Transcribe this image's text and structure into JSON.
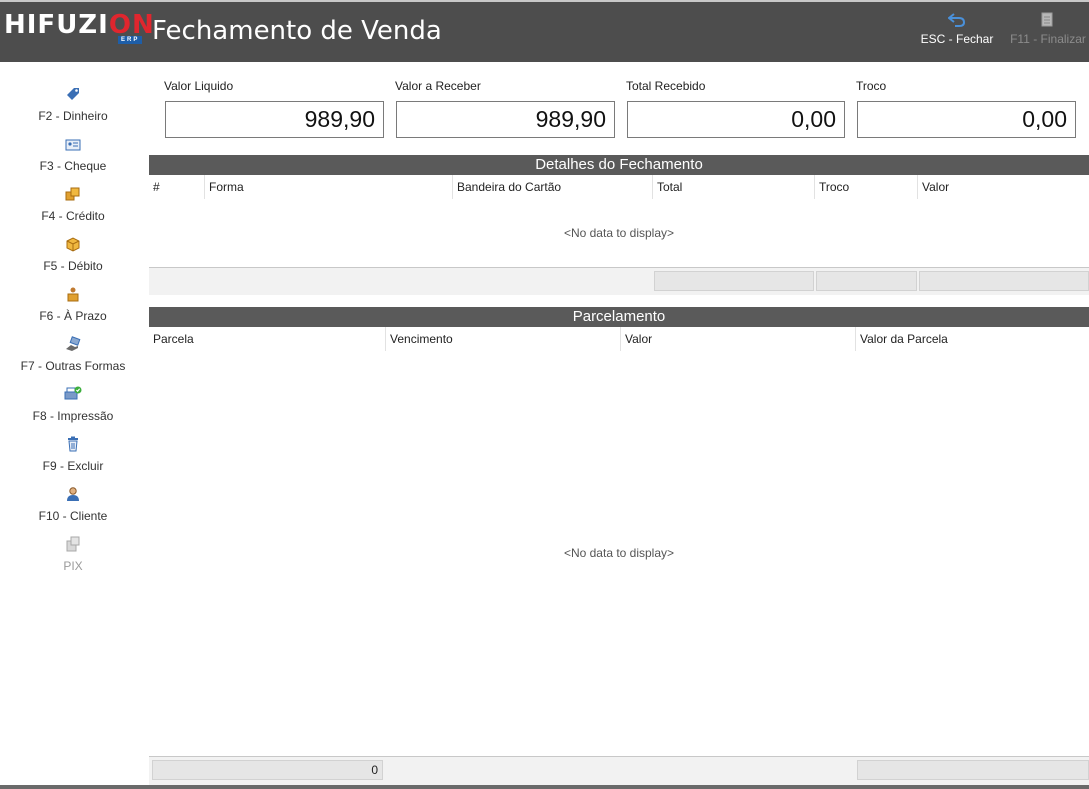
{
  "brand": {
    "logo_main_a": "HIFUZI",
    "logo_main_b": "ON",
    "logo_sub": "ERP"
  },
  "header": {
    "title": "Fechamento de Venda",
    "esc_label": "ESC - Fechar",
    "finalize_label": "F11 - Finalizar"
  },
  "sidebar": {
    "items": [
      {
        "label": "F2 - Dinheiro",
        "icon": "money-tag-icon"
      },
      {
        "label": "F3 - Cheque",
        "icon": "id-card-icon"
      },
      {
        "label": "F4 - Crédito",
        "icon": "boxes-icon"
      },
      {
        "label": "F5 - Débito",
        "icon": "box-icon"
      },
      {
        "label": "F6 - À Prazo",
        "icon": "person-box-icon"
      },
      {
        "label": "F7 - Outras Formas",
        "icon": "hand-money-icon"
      },
      {
        "label": "F8 - Impressão",
        "icon": "printer-check-icon"
      },
      {
        "label": "F9 - Excluir",
        "icon": "trash-icon"
      },
      {
        "label": "F10 - Cliente",
        "icon": "user-icon"
      },
      {
        "label": "PIX",
        "icon": "pix-icon"
      }
    ]
  },
  "totals": {
    "valor_liquido": {
      "label": "Valor Liquido",
      "value": "989,90"
    },
    "valor_receber": {
      "label": "Valor a Receber",
      "value": "989,90"
    },
    "total_recebido": {
      "label": "Total Recebido",
      "value": "0,00"
    },
    "troco": {
      "label": "Troco",
      "value": "0,00"
    }
  },
  "fechamento": {
    "title": "Detalhes do Fechamento",
    "columns": [
      "#",
      "Forma",
      "Bandeira do Cartão",
      "Total",
      "Troco",
      "Valor"
    ],
    "empty_text": "<No data to display>"
  },
  "parcelamento": {
    "title": "Parcelamento",
    "columns": [
      "Parcela",
      "Vencimento",
      "Valor",
      "Valor da Parcela"
    ],
    "empty_text": "<No data to display>",
    "footer_count": "0"
  },
  "colors": {
    "header_bg": "#4d4d4d",
    "section_bg": "#5a5a5a",
    "logo_accent": "#e0262e"
  }
}
